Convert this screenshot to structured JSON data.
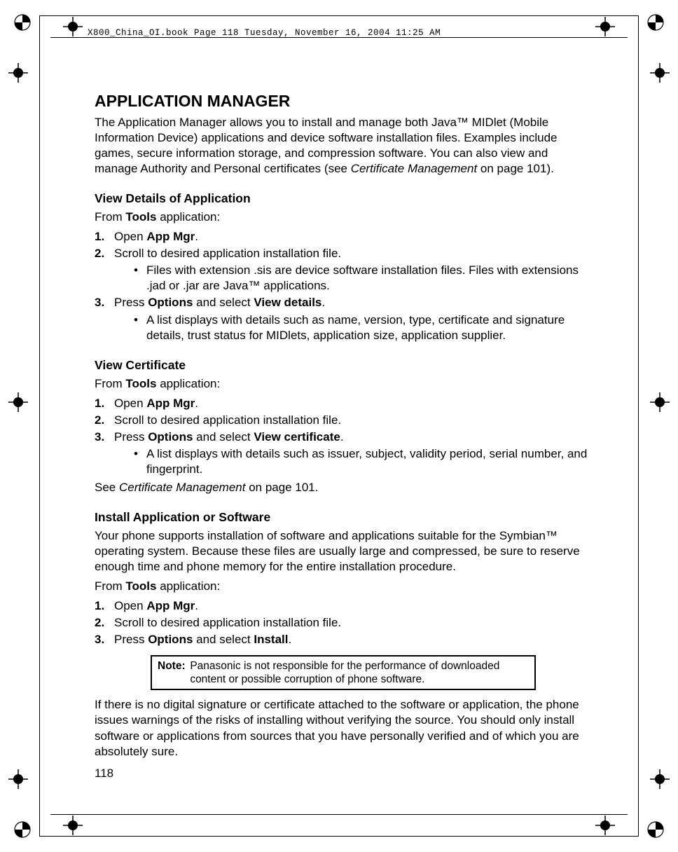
{
  "header": "X800_China_OI.book  Page 118  Tuesday, November 16, 2004  11:25 AM",
  "page_number": "118",
  "title": "APPLICATION MANAGER",
  "intro": "The Application Manager allows you to install and manage both Java™ MIDlet (Mobile Information Device) applications and device software installation files. Examples include games, secure information storage, and compression software. You can also view and manage Authority and Personal certificates (see ",
  "intro_italic": "Certificate Management",
  "intro_tail": " on page 101).",
  "sec1": {
    "heading": "View Details of Application",
    "from_prefix": "From ",
    "from_bold": "Tools",
    "from_suffix": " application:",
    "s1_open_bold": "App Mgr",
    "s1_open_prefix": "Open ",
    "s1_open_suffix": ".",
    "s2": "Scroll to desired application installation file.",
    "b1": "Files with extension .sis are device software installation files. Files with extensions .jad or .jar are Java™ applications.",
    "s3_prefix": "Press ",
    "s3_bold1": "Options",
    "s3_mid": " and select ",
    "s3_bold2": "View details",
    "s3_suffix": ".",
    "b2": "A list displays with details such as name, version, type, certificate and signature details, trust status for MIDlets, application size, application supplier."
  },
  "sec2": {
    "heading": "View Certificate",
    "from_prefix": "From ",
    "from_bold": "Tools",
    "from_suffix": " application:",
    "s1_open_bold": "App Mgr",
    "s1_open_prefix": "Open ",
    "s1_open_suffix": ".",
    "s2": "Scroll to desired application installation file.",
    "s3_prefix": "Press ",
    "s3_bold1": "Options",
    "s3_mid": " and select ",
    "s3_bold2": "View certificate",
    "s3_suffix": ".",
    "b1": "A list displays with details such as issuer, subject, validity period, serial number, and fingerprint.",
    "see_prefix": "See ",
    "see_italic": "Certificate Management",
    "see_suffix": " on page 101."
  },
  "sec3": {
    "heading": "Install Application or Software",
    "intro": "Your phone supports installation of software and applications suitable for the Symbian™ operating system. Because these files are usually large and compressed, be sure to reserve enough time and phone memory for the entire installation procedure.",
    "from_prefix": "From ",
    "from_bold": "Tools",
    "from_suffix": " application:",
    "s1_open_bold": "App Mgr",
    "s1_open_prefix": "Open ",
    "s1_open_suffix": ".",
    "s2": "Scroll to desired application installation file.",
    "s3_prefix": "Press ",
    "s3_bold1": "Options",
    "s3_mid": " and select ",
    "s3_bold2": "Install",
    "s3_suffix": ".",
    "note_label": "Note",
    "note_body": "Panasonic is not responsible for the performance of downloaded content or possible corruption of phone software.",
    "after_note": "If there is no digital signature or certificate attached to the software or application, the phone issues warnings of the risks of installing without verifying the source. You should only install software or applications from sources that you have personally verified and of which you are absolutely sure."
  },
  "num1": "1.",
  "num2": "2.",
  "num3": "3."
}
